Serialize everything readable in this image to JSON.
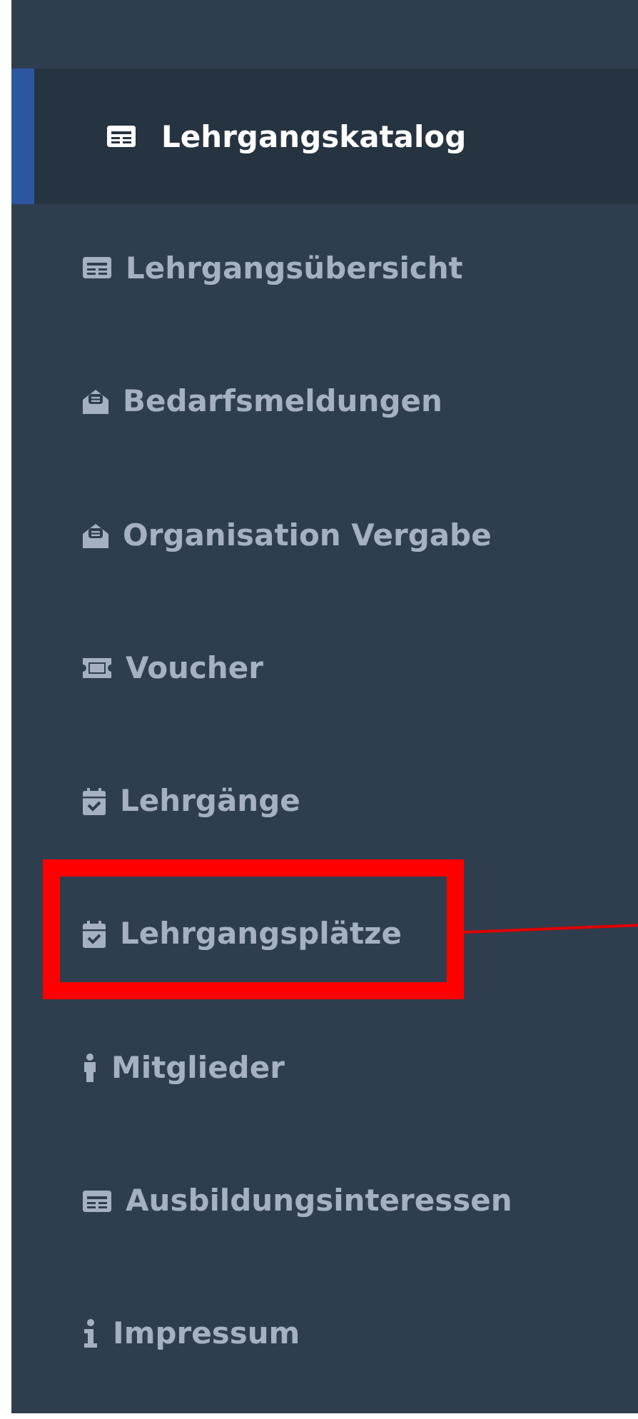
{
  "menu": [
    {
      "label": "Lehrgangskatalog",
      "kind": "table",
      "selected": true,
      "highlighted": false
    },
    {
      "label": "Lehrgangsübersicht",
      "kind": "table",
      "selected": false,
      "highlighted": false
    },
    {
      "label": "Bedarfsmeldungen",
      "kind": "envelope",
      "selected": false,
      "highlighted": false
    },
    {
      "label": "Organisation Vergabe",
      "kind": "envelope",
      "selected": false,
      "highlighted": false
    },
    {
      "label": "Voucher",
      "kind": "ticket",
      "selected": false,
      "highlighted": false
    },
    {
      "label": "Lehrgänge",
      "kind": "calendar",
      "selected": false,
      "highlighted": false
    },
    {
      "label": "Lehrgangsplätze",
      "kind": "calendar",
      "selected": false,
      "highlighted": true
    },
    {
      "label": "Mitglieder",
      "kind": "person",
      "selected": false,
      "highlighted": false
    },
    {
      "label": "Ausbildungsinteressen",
      "kind": "table",
      "selected": false,
      "highlighted": false
    },
    {
      "label": "Impressum",
      "kind": "info",
      "selected": false,
      "highlighted": false
    }
  ]
}
